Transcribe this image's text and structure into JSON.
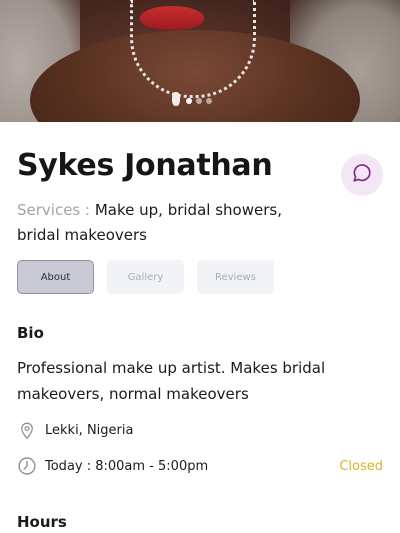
{
  "hero": {
    "carousel_total": 3,
    "carousel_active_index": 0
  },
  "profile": {
    "name": "Sykes Jonathan",
    "services_label": "Services :",
    "services_value": "Make up, bridal showers, bridal makeovers"
  },
  "tabs": [
    {
      "label": "About",
      "active": true
    },
    {
      "label": "Gallery",
      "active": false
    },
    {
      "label": "Reviews",
      "active": false
    }
  ],
  "bio": {
    "heading": "Bio",
    "text": "Professional make up artist. Makes bridal makeovers, normal makeovers"
  },
  "info": {
    "location": "Lekki, Nigeria",
    "hours_today": "Today : 8:00am - 5:00pm",
    "status": "Closed"
  },
  "hours": {
    "heading": "Hours"
  },
  "colors": {
    "accent_chat_bg": "#f3e7f5",
    "accent_chat_icon": "#7e2a8a",
    "active_tab_bg": "#c9cad6",
    "status_closed": "#e0b02a"
  },
  "icons": {
    "chat": "chat-bubble-icon",
    "location": "map-pin-icon",
    "time": "clock-icon"
  }
}
